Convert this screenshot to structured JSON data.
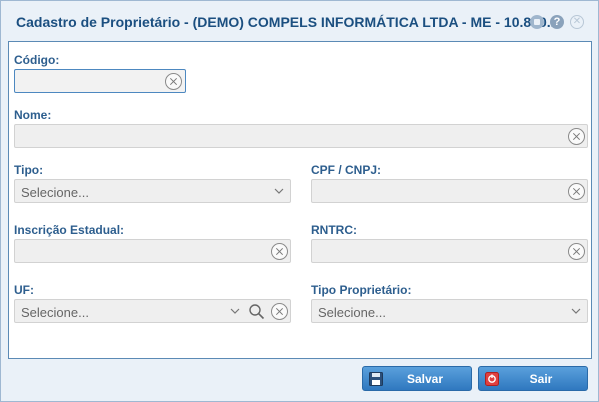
{
  "window": {
    "title": "Cadastro de Proprietário - (DEMO) COMPELS INFORMÁTICA LTDA - ME - 10.810...",
    "help_symbol": "?",
    "close_symbol": "✕"
  },
  "form": {
    "codigo": {
      "label": "Código:",
      "value": ""
    },
    "nome": {
      "label": "Nome:",
      "value": ""
    },
    "tipo": {
      "label": "Tipo:",
      "placeholder": "Selecione..."
    },
    "cpf_cnpj": {
      "label": "CPF / CNPJ:",
      "value": ""
    },
    "inscricao_estadual": {
      "label": "Inscrição Estadual:",
      "value": ""
    },
    "rntrc": {
      "label": "RNTRC:",
      "value": ""
    },
    "uf": {
      "label": "UF:",
      "placeholder": "Selecione..."
    },
    "tipo_proprietario": {
      "label": "Tipo Proprietário:",
      "placeholder": "Selecione..."
    }
  },
  "buttons": {
    "save_label": "Salvar",
    "exit_label": "Sair"
  },
  "icons": {
    "save": "floppy-disk-icon",
    "exit": "exit-icon",
    "clear": "clear-circle-x-icon",
    "dropdown": "chevron-down-icon",
    "search": "search-icon"
  },
  "colors": {
    "label": "#2d5e8e",
    "title": "#1b4f80",
    "button": "#3f8ad0",
    "field_bg": "#efefef",
    "focus_border": "#4d88c0"
  }
}
